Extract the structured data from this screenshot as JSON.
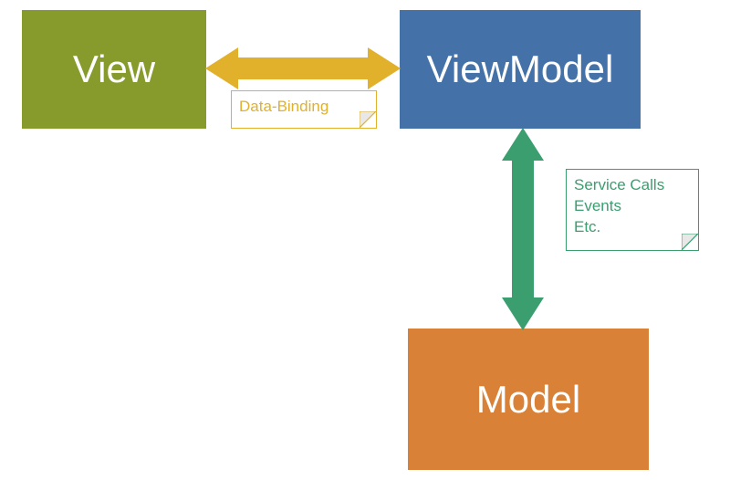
{
  "boxes": {
    "view": {
      "label": "View",
      "color": "#869b2b"
    },
    "viewmodel": {
      "label": "ViewModel",
      "color": "#4472a8"
    },
    "model": {
      "label": "Model",
      "color": "#d98237"
    }
  },
  "arrows": {
    "horizontal": {
      "color": "#e1b12c"
    },
    "vertical": {
      "color": "#3b9e6f"
    }
  },
  "notes": {
    "databinding": {
      "text": "Data-Binding",
      "borderColor": "#e1b12c",
      "textColor": "#e1b12c"
    },
    "services": {
      "line1": "Service Calls",
      "line2": "Events",
      "line3": "Etc.",
      "borderColor": "#3b9e6f",
      "textColor": "#3b9e6f"
    }
  }
}
